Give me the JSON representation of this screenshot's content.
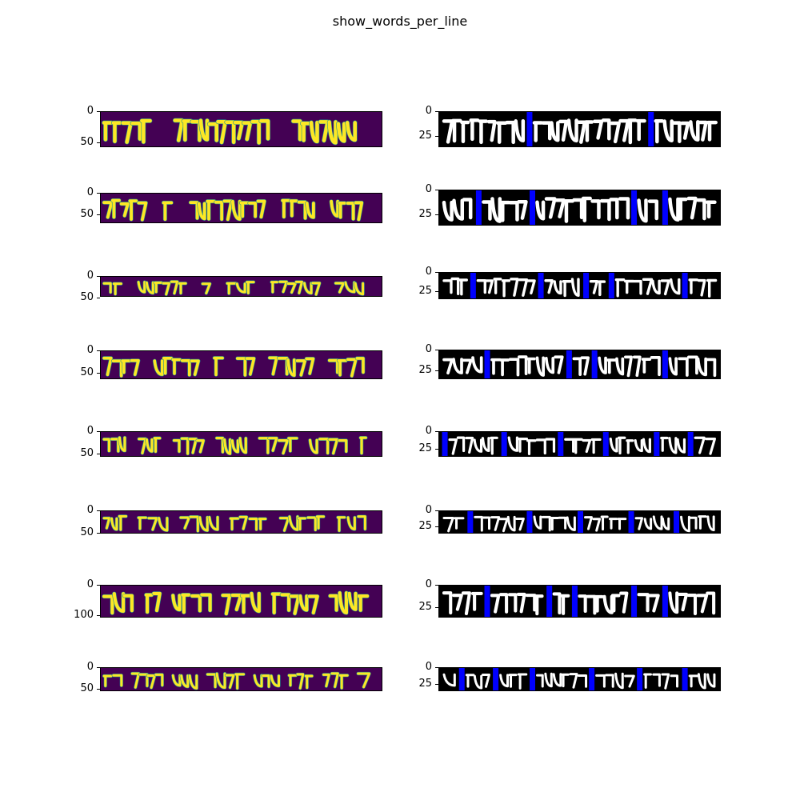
{
  "chart_data": {
    "type": "image-grid",
    "title": "show_words_per_line",
    "colors": {
      "viridis_bg": "#440154",
      "viridis_fg": "#fde725",
      "viridis_edge": "#21918c",
      "binary_bg": "#000000",
      "binary_fg": "#ffffff",
      "separator": "#0000ff"
    },
    "rows": [
      {
        "left": {
          "ylim": [
            57,
            0
          ],
          "yticks": [
            "0",
            "50"
          ],
          "words": [
            3,
            6,
            4
          ]
        },
        "right": {
          "ylim": [
            36,
            0
          ],
          "yticks": [
            "0",
            "25"
          ],
          "separators": [
            0.32,
            0.75
          ],
          "words": [
            4,
            6,
            3
          ]
        }
      },
      {
        "left": {
          "ylim": [
            70,
            0
          ],
          "yticks": [
            "0",
            "50"
          ],
          "words": [
            4,
            1,
            7,
            3,
            3
          ]
        },
        "right": {
          "ylim": [
            36,
            0
          ],
          "yticks": [
            "0",
            "25"
          ],
          "separators": [
            0.14,
            0.33,
            0.69,
            0.8
          ],
          "words": [
            3,
            3,
            7,
            1,
            4
          ]
        }
      },
      {
        "left": {
          "ylim": [
            49,
            0
          ],
          "yticks": [
            "0",
            "50"
          ],
          "words": [
            2,
            5,
            1,
            3,
            5,
            3
          ]
        },
        "right": {
          "ylim": [
            36,
            0
          ],
          "yticks": [
            "0",
            "25"
          ],
          "separators": [
            0.12,
            0.36,
            0.52,
            0.61,
            0.87
          ],
          "words": [
            3,
            5,
            3,
            1,
            5,
            2
          ]
        }
      },
      {
        "left": {
          "ylim": [
            65,
            0
          ],
          "yticks": [
            "0",
            "50"
          ],
          "words": [
            4,
            5,
            1,
            2,
            5,
            4
          ]
        },
        "right": {
          "ylim": [
            36,
            0
          ],
          "yticks": [
            "0",
            "25"
          ],
          "separators": [
            0.17,
            0.46,
            0.55,
            0.8
          ],
          "words": [
            4,
            5,
            1,
            5,
            4
          ]
        }
      },
      {
        "left": {
          "ylim": [
            57,
            0
          ],
          "yticks": [
            "0",
            "50"
          ],
          "words": [
            3,
            3,
            4,
            4,
            5,
            5,
            1
          ]
        },
        "right": {
          "ylim": [
            36,
            0
          ],
          "yticks": [
            "0",
            "25"
          ],
          "separators": [
            0.02,
            0.23,
            0.43,
            0.59,
            0.77,
            0.89
          ],
          "words": [
            5,
            5,
            4,
            4,
            3,
            3
          ]
        }
      },
      {
        "left": {
          "ylim": [
            51,
            0
          ],
          "yticks": [
            "0",
            "50"
          ],
          "words": [
            3,
            4,
            5,
            5,
            6,
            4
          ]
        },
        "right": {
          "ylim": [
            36,
            0
          ],
          "yticks": [
            "0",
            "25"
          ],
          "separators": [
            0.11,
            0.32,
            0.5,
            0.68,
            0.84
          ],
          "words": [
            4,
            6,
            5,
            5,
            4,
            3
          ]
        }
      },
      {
        "left": {
          "ylim": [
            107,
            0
          ],
          "yticks": [
            "0",
            "100"
          ],
          "words": [
            4,
            2,
            5,
            5,
            6,
            5
          ]
        },
        "right": {
          "ylim": [
            36,
            0
          ],
          "yticks": [
            "0",
            "25"
          ],
          "separators": [
            0.17,
            0.39,
            0.48,
            0.69,
            0.8
          ],
          "words": [
            5,
            6,
            5,
            2,
            5,
            4
          ]
        }
      },
      {
        "left": {
          "ylim": [
            55,
            0
          ],
          "yticks": [
            "0",
            "50"
          ],
          "words": [
            3,
            5,
            4,
            6,
            4,
            4,
            4,
            2
          ]
        },
        "right": {
          "ylim": [
            36,
            0
          ],
          "yticks": [
            "0",
            "25"
          ],
          "separators": [
            0.08,
            0.2,
            0.33,
            0.54,
            0.71,
            0.87
          ],
          "words": [
            2,
            4,
            4,
            6,
            4,
            5,
            3
          ]
        }
      }
    ]
  }
}
